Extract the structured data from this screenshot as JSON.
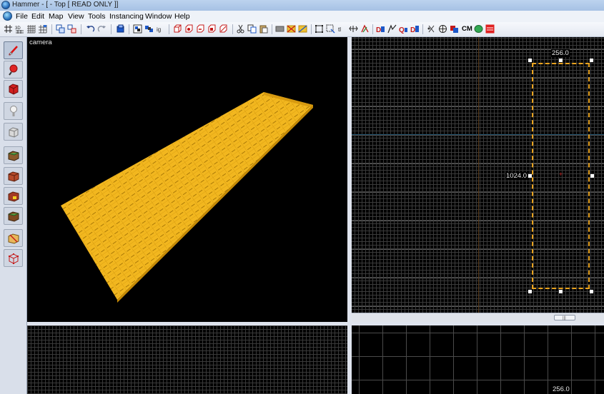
{
  "window": {
    "title": "Hammer - [ - Top [ READ ONLY ]]"
  },
  "menu": {
    "items": [
      "File",
      "Edit",
      "Map",
      "View",
      "Tools",
      "Instancing",
      "Window",
      "Help"
    ]
  },
  "toolbar": {
    "cm_label": "CM",
    "button_icons": [
      "grid-toggle-icon",
      "3d-grid-icon",
      "grid-smaller-icon",
      "grid-larger-icon",
      "group-icon",
      "ungroup-icon",
      "undo-icon",
      "redo-icon",
      "carve-icon",
      "entity-report-icon",
      "texture-lock-icon",
      "flip-icon",
      "hollow-icon",
      "tie-to-entity-icon",
      "move-to-world-icon",
      "hide-icon",
      "show-all-icon",
      "cut-icon",
      "copy-icon",
      "paste-icon",
      "gray-block-icon",
      "clip-icon",
      "clip-toggle-icon",
      "select-icon",
      "select-by-handle-icon",
      "texture-icon",
      "decal-icon",
      "vertex-icon",
      "run-map-icon",
      "cordon-icon",
      "sound-icon",
      "displacement-icon",
      "visgroup-icon",
      "model-icon",
      "instance-icon",
      "no-draw-icon"
    ]
  },
  "tools": {
    "icons": [
      "selection-tool-icon",
      "magnify-tool-icon",
      "camera-tool-icon",
      "entity-tool-icon",
      "block-tool-icon",
      "texture-app-icon",
      "apply-texture-icon",
      "decal-tool-icon",
      "overlay-tool-icon",
      "clip-tool-icon",
      "vertex-tool-icon"
    ],
    "active_index": 0
  },
  "viewports": {
    "camera_label": "camera",
    "top": {
      "width_label": "256.0",
      "height_label": "1024.0"
    },
    "bottom_right": {
      "width_label": "256.0"
    }
  },
  "colors": {
    "brush_fill": "#f2b71f",
    "brush_edge": "#c68a05",
    "selection_outline": "#e8a21e",
    "grid_minor": "#3b3b3b",
    "grid_major": "#5c5c5c",
    "viewport_background": "#000000"
  }
}
